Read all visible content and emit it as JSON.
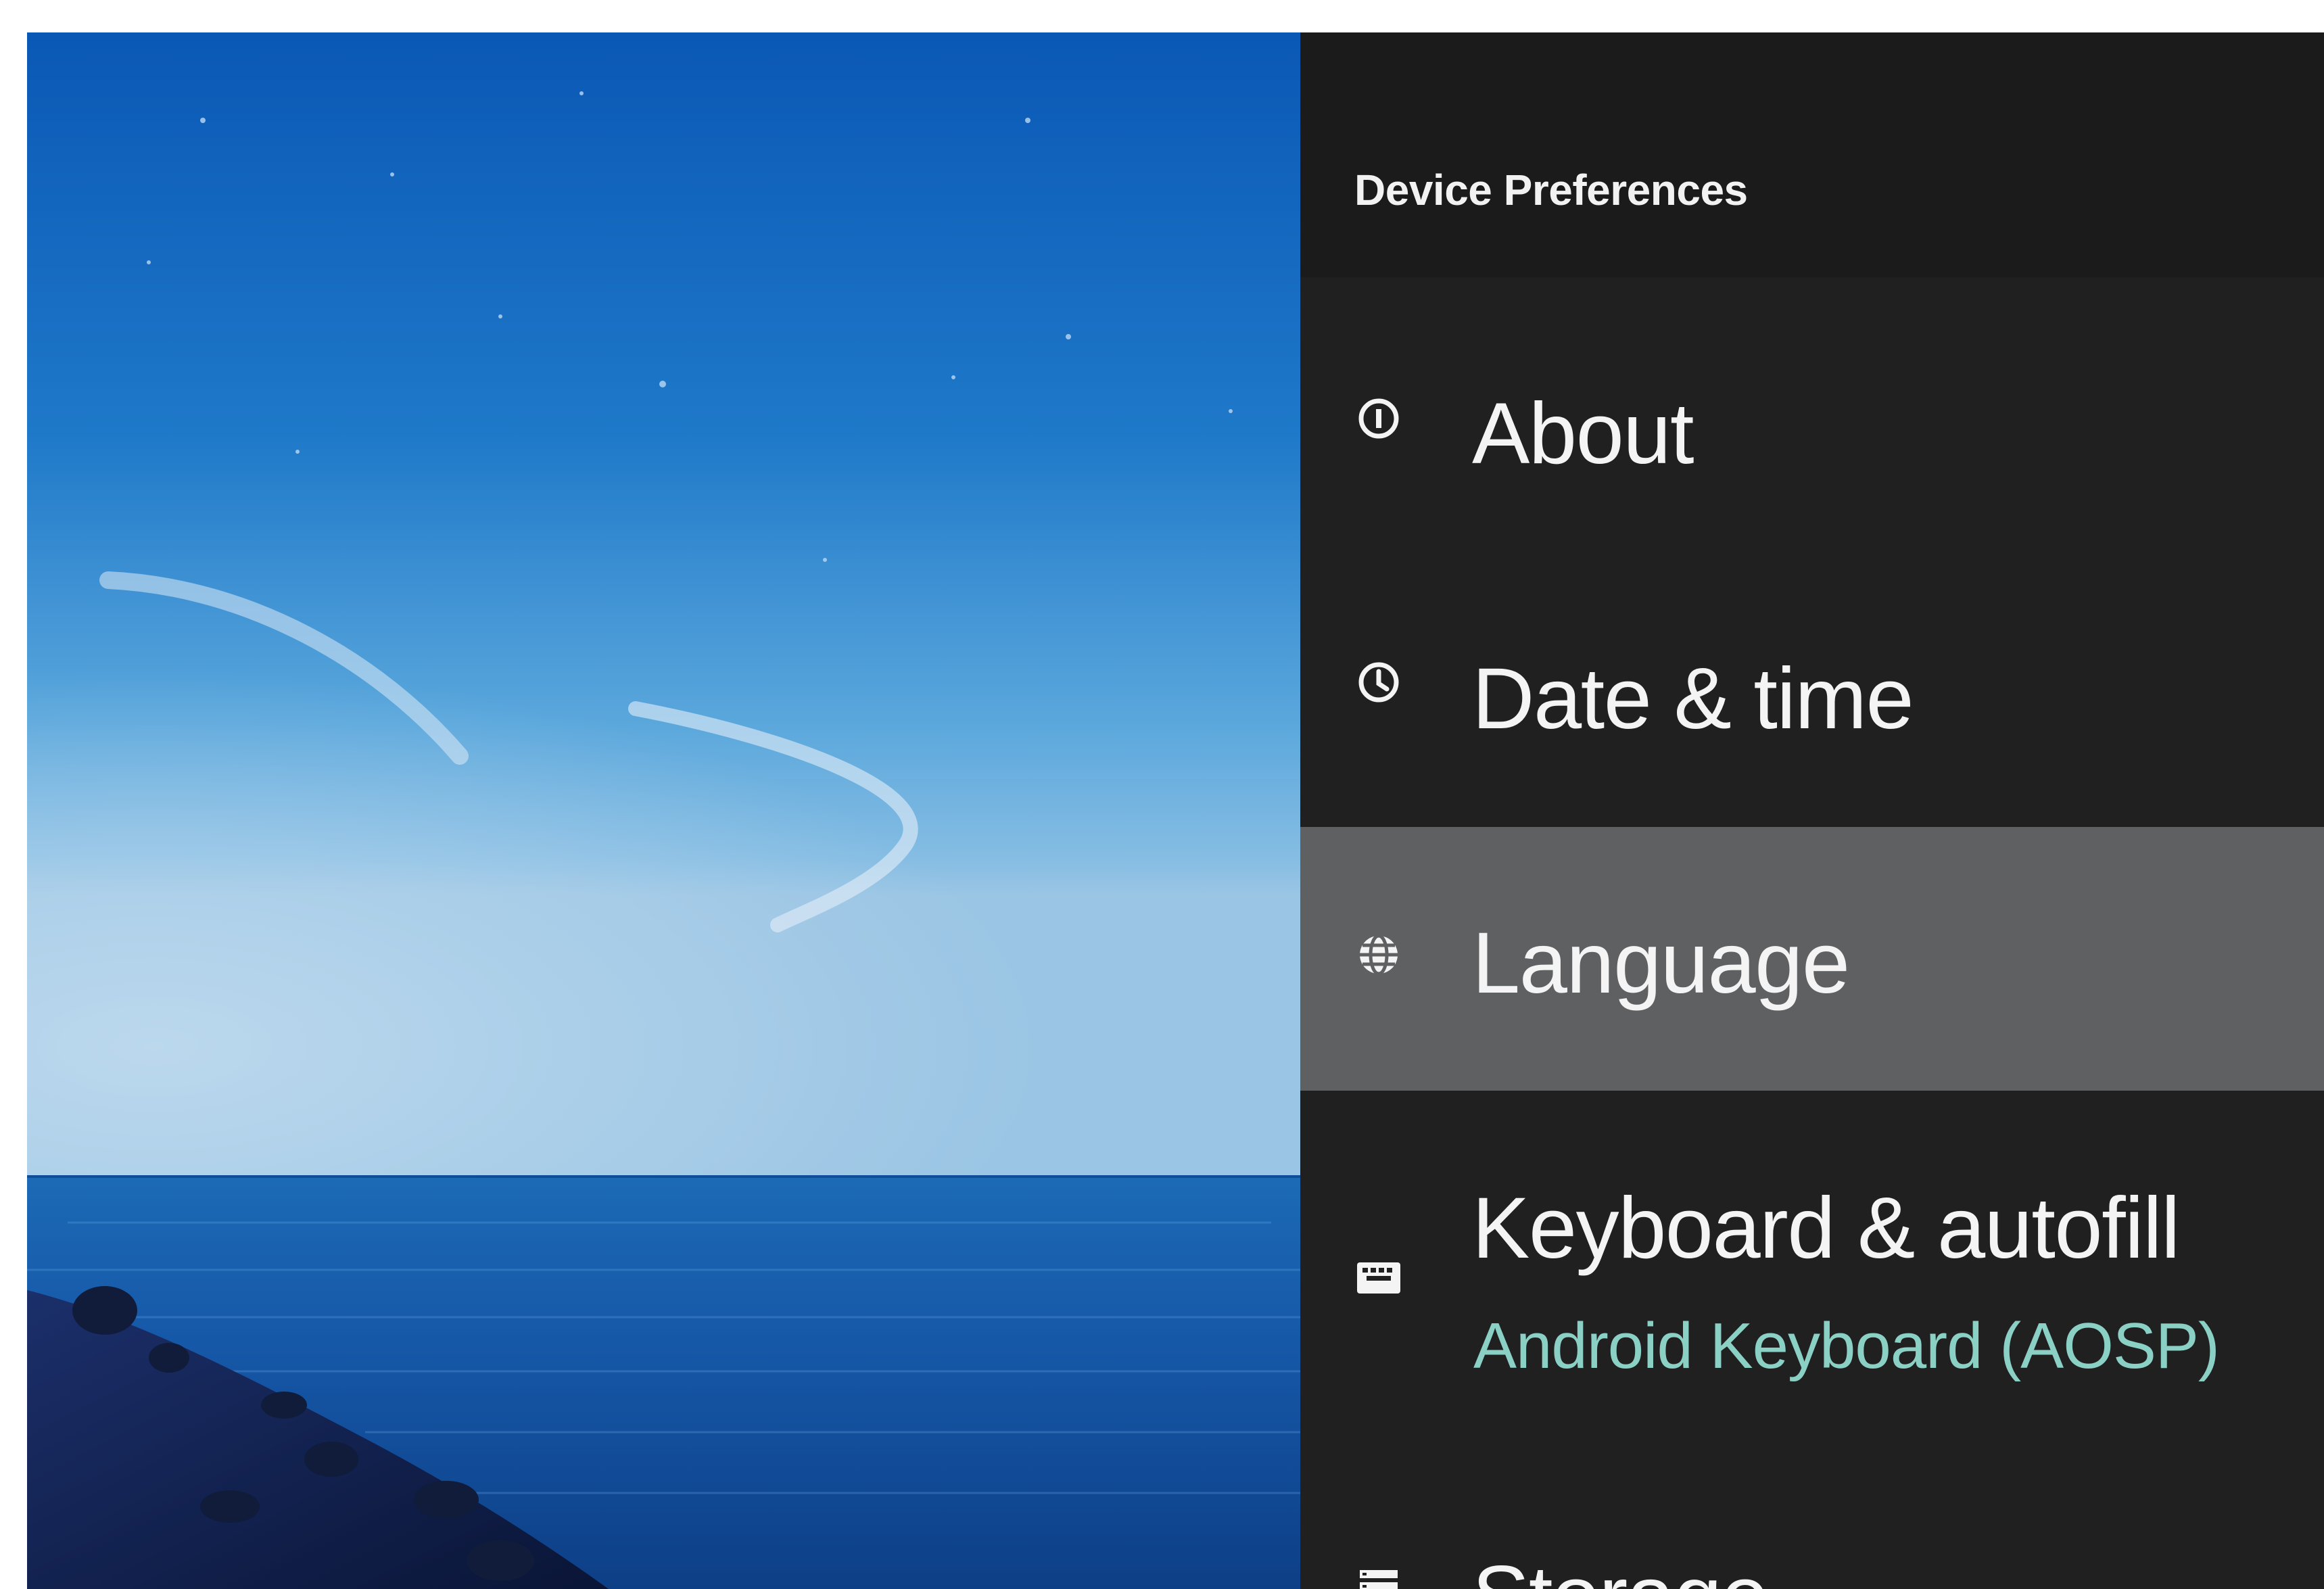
{
  "panel": {
    "title": "Device Preferences",
    "items": [
      {
        "label": "About",
        "icon": "info-icon"
      },
      {
        "label": "Date & time",
        "icon": "clock-icon"
      },
      {
        "label": "Language",
        "icon": "globe-icon",
        "selected": true
      },
      {
        "label": "Keyboard & autofill",
        "subtitle": "Android Keyboard (AOSP)",
        "icon": "keyboard-icon"
      },
      {
        "label": "Storage",
        "icon": "storage-icon"
      }
    ]
  },
  "colors": {
    "panel_background": "#202020",
    "header_background": "#1b1b1b",
    "selected_background": "#5f6062",
    "subtitle_accent": "#8ad0c4",
    "text": "#f4f4f4"
  }
}
